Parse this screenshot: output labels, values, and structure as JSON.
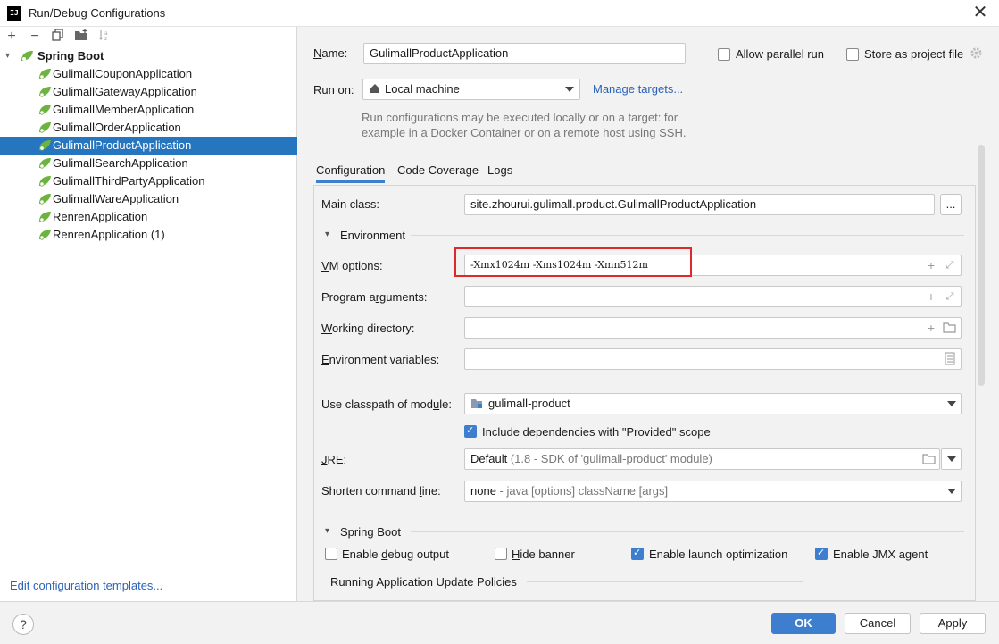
{
  "window": {
    "title": "Run/Debug Configurations",
    "logo": "IJ"
  },
  "toolbar": {
    "icons": [
      "add-icon",
      "remove-icon",
      "copy-icon",
      "folder-add-icon",
      "sort-icon"
    ]
  },
  "tree": {
    "group": "Spring Boot",
    "items": [
      {
        "label": "GulimallCouponApplication"
      },
      {
        "label": "GulimallGatewayApplication"
      },
      {
        "label": "GulimallMemberApplication"
      },
      {
        "label": "GulimallOrderApplication"
      },
      {
        "label": "GulimallProductApplication",
        "selected": true
      },
      {
        "label": "GulimallSearchApplication"
      },
      {
        "label": "GulimallThirdPartyApplication"
      },
      {
        "label": "GulimallWareApplication"
      },
      {
        "label": "RenrenApplication"
      },
      {
        "label": "RenrenApplication (1)"
      }
    ]
  },
  "edit_templates": "Edit configuration templates...",
  "name": {
    "label": "Name:",
    "value": "GulimallProductApplication"
  },
  "allow_parallel": {
    "label": "Allow parallel run",
    "checked": false
  },
  "store_as_project": {
    "label": "Store as project file",
    "checked": false
  },
  "run_on": {
    "label": "Run on:",
    "value": "Local machine",
    "manage": "Manage targets..."
  },
  "run_hint": {
    "line1": "Run configurations may be executed locally or on a target: for",
    "line2": "example in a Docker Container or on a remote host using SSH."
  },
  "tabs": [
    {
      "label": "Configuration",
      "active": true
    },
    {
      "label": "Code Coverage"
    },
    {
      "label": "Logs"
    }
  ],
  "main_class": {
    "label": "Main class:",
    "value": "site.zhourui.gulimall.product.GulimallProductApplication",
    "browse": "..."
  },
  "environment": {
    "header": "Environment"
  },
  "vm_options": {
    "label": "VM options:",
    "value": "-Xmx1024m -Xms1024m -Xmn512m"
  },
  "program_args": {
    "label": "Program arguments:",
    "value": ""
  },
  "working_dir": {
    "label": "Working directory:",
    "value": ""
  },
  "env_vars": {
    "label": "Environment variables:",
    "value": ""
  },
  "classpath": {
    "label": "Use classpath of module:",
    "value": "gulimall-product"
  },
  "include_deps": {
    "label": "Include dependencies with \"Provided\" scope",
    "checked": true
  },
  "jre": {
    "label": "JRE:",
    "value": "Default",
    "detail": "(1.8 - SDK of 'gulimall-product' module)"
  },
  "shorten": {
    "label": "Shorten command line:",
    "value": "none",
    "detail": "- java [options] className [args]"
  },
  "spring_boot": {
    "header": "Spring Boot",
    "debug_output": {
      "label": "Enable debug output",
      "checked": false
    },
    "hide_banner": {
      "label": "Hide banner",
      "checked": false
    },
    "launch_opt": {
      "label": "Enable launch optimization",
      "checked": true
    },
    "jmx": {
      "label": "Enable JMX agent",
      "checked": true
    },
    "update_policies": "Running Application Update Policies"
  },
  "buttons": {
    "ok": "OK",
    "cancel": "Cancel",
    "apply": "Apply",
    "help": "?"
  },
  "colors": {
    "accent": "#3d7fce",
    "selection": "#2675bf",
    "highlight_box": "#e02828",
    "spring_green": "#6db33f"
  }
}
